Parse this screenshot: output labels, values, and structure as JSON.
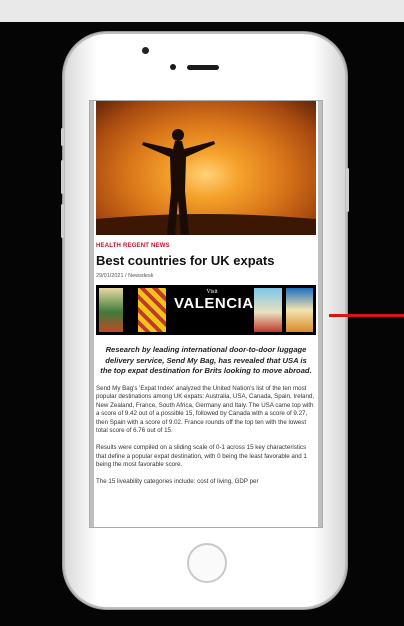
{
  "article": {
    "categories": "HEALTH REGENT NEWS",
    "title": "Best countries for UK expats",
    "meta": "29/01/2021 / Newsdesk",
    "lead": "Research by leading international door-to-door luggage delivery service, Send My Bag, has revealed that USA is the top expat destination for Brits looking to move abroad.",
    "paragraphs": [
      "Send My Bag's 'Expat Index' analyzed the United Nation's list of the ten most popular destinations among UK expats: Australia, USA, Canada, Spain, Ireland, New Zealand, France, South Africa, Germany and Italy. The USA came top with a score of 9.42 out of a possible 15, followed by Canada with a score of 9.27, then Spain with a score of 9.02. France rounds off the top ten with the lowest total score of 6.76 out of 15.",
      "Results were compiled on a sliding scale of 0-1 across 15 key characteristics that define a popular expat destination, with 0 being the least favorable and 1 being the most favorable score.",
      "The 15 liveability categories include: cost of living, GDP per"
    ]
  },
  "banner": {
    "visit_label": "Visit",
    "city": "VALENCIA"
  },
  "colors": {
    "category_red": "#c8102e",
    "pointer_red": "#d81414"
  }
}
